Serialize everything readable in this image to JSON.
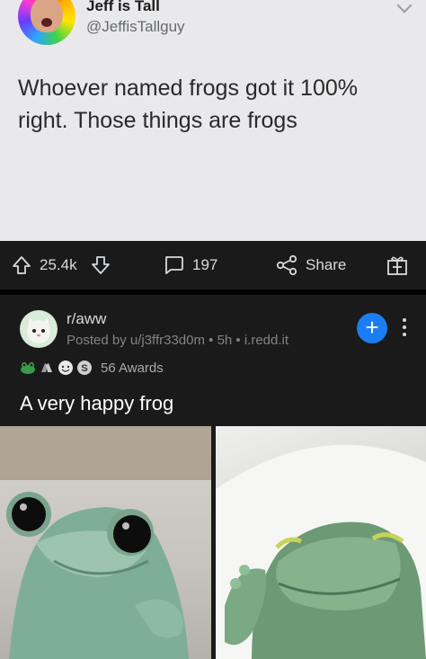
{
  "tweet": {
    "display_name": "Jeff is Tall",
    "handle": "@JeffisTallguy",
    "text": "Whoever named frogs got it 100% right. Those things are frogs"
  },
  "action_bar": {
    "upvotes": "25.4k",
    "comments": "197",
    "share_label": "Share"
  },
  "post": {
    "subreddit": "r/aww",
    "meta": "Posted by u/j3ffr33d0m • 5h • i.redd.it",
    "awards_count": "56 Awards",
    "title": "A very happy frog"
  },
  "colors": {
    "background": "#1a1a1b",
    "join_button": "#1a7ef2",
    "tweet_background": "#e9e9ec"
  }
}
